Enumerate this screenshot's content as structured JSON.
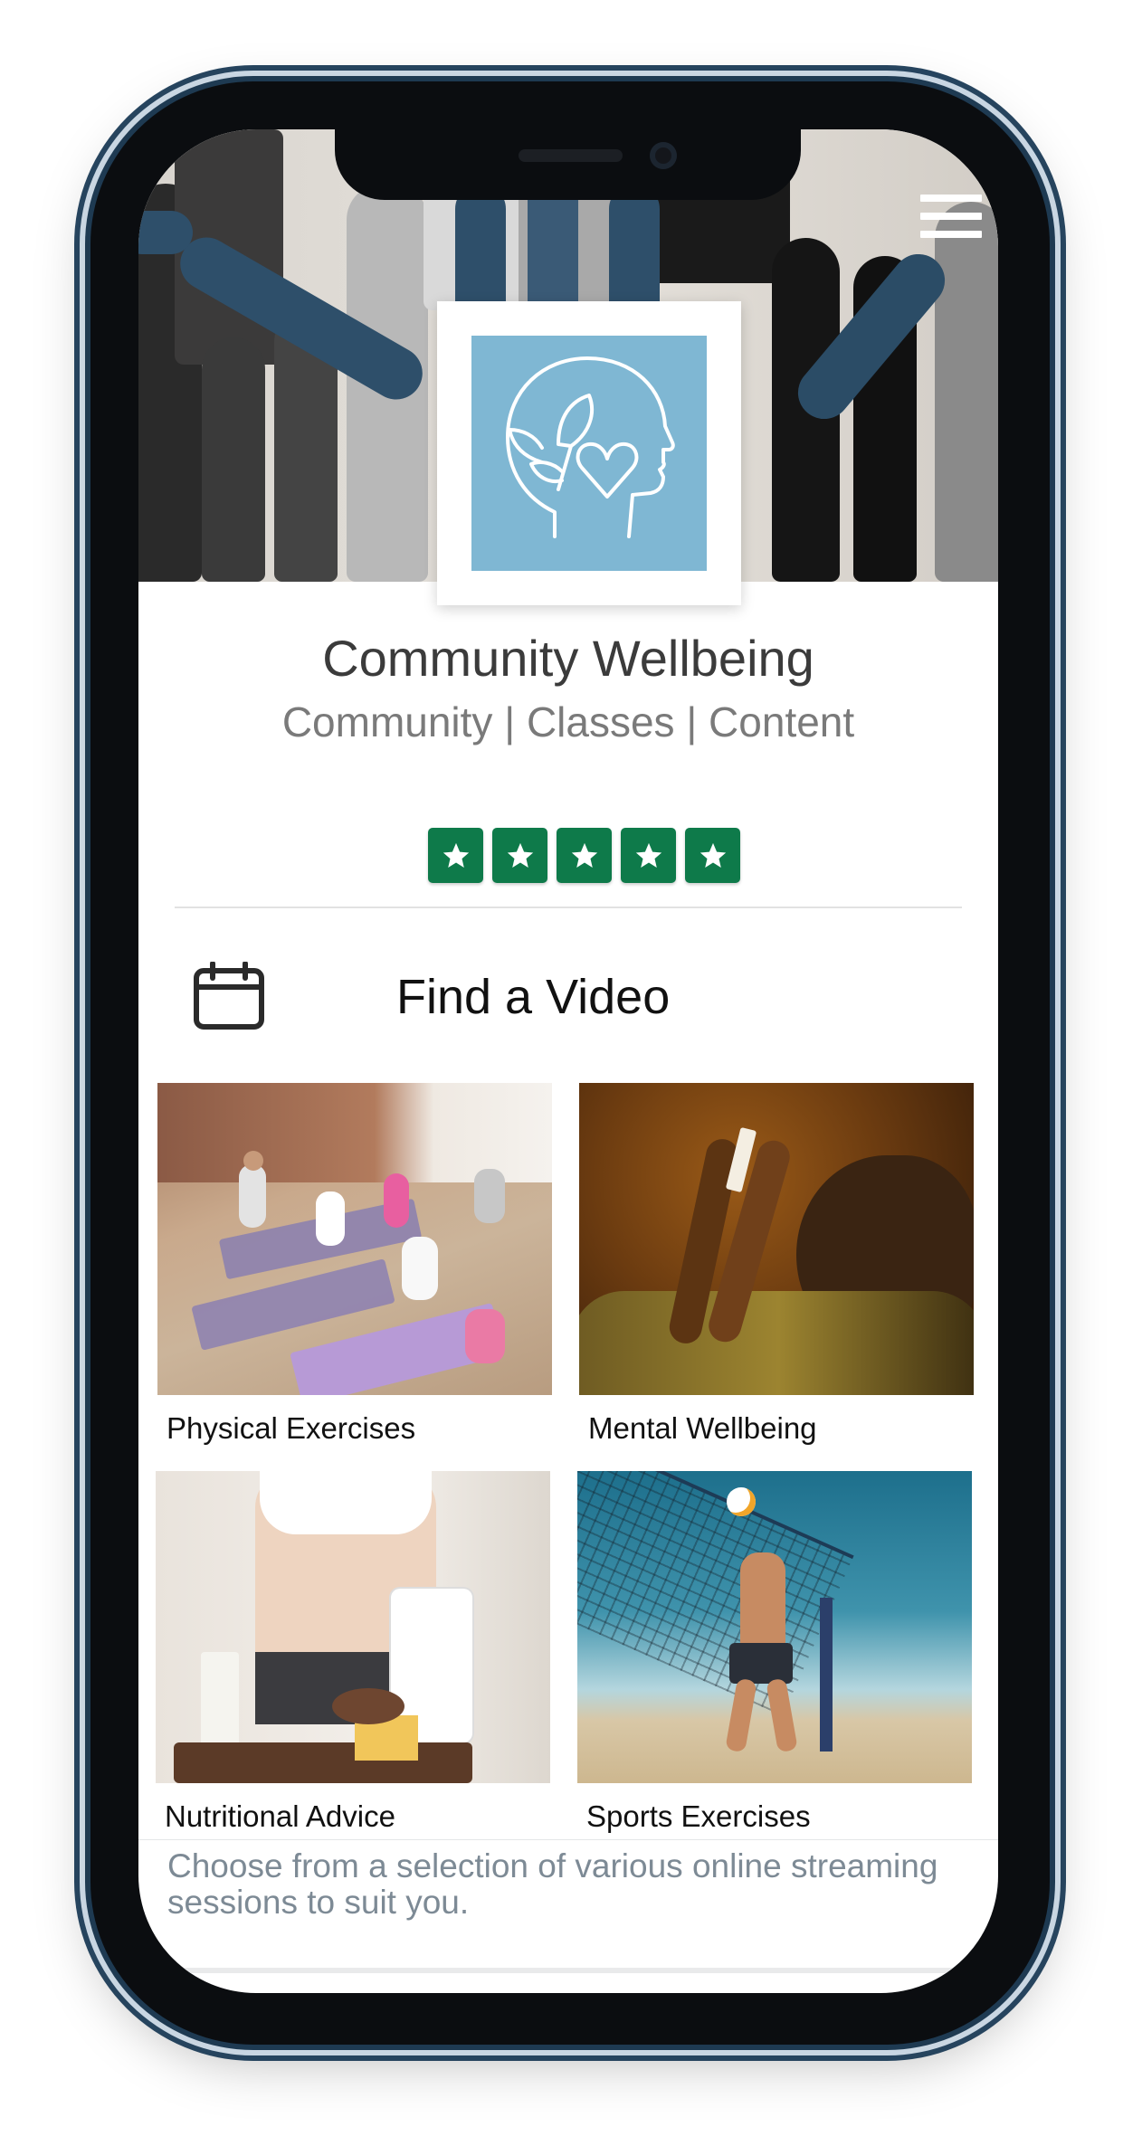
{
  "app": {
    "title": "Community Wellbeing",
    "subtitle": "Community | Classes | Content"
  },
  "rating": {
    "stars": 5,
    "max": 5
  },
  "colors": {
    "brand_blue": "#7fb7d3",
    "star_green": "#0e7a4a",
    "text_dark": "#3b3b3b",
    "text_muted": "#7a7a7a"
  },
  "find": {
    "label": "Find a Video",
    "icon": "calendar-icon"
  },
  "categories": [
    {
      "label": "Physical Exercises",
      "image": "yoga-class-photo"
    },
    {
      "label": "Mental Wellbeing",
      "image": "man-with-phone-photo"
    },
    {
      "label": "Nutritional Advice",
      "image": "nutrition-photo"
    },
    {
      "label": "Sports Exercises",
      "image": "beach-volleyball-photo"
    }
  ],
  "description": "Choose from a selection of various online streaming sessions to suit you.",
  "menu": {
    "icon": "hamburger-menu-icon"
  }
}
